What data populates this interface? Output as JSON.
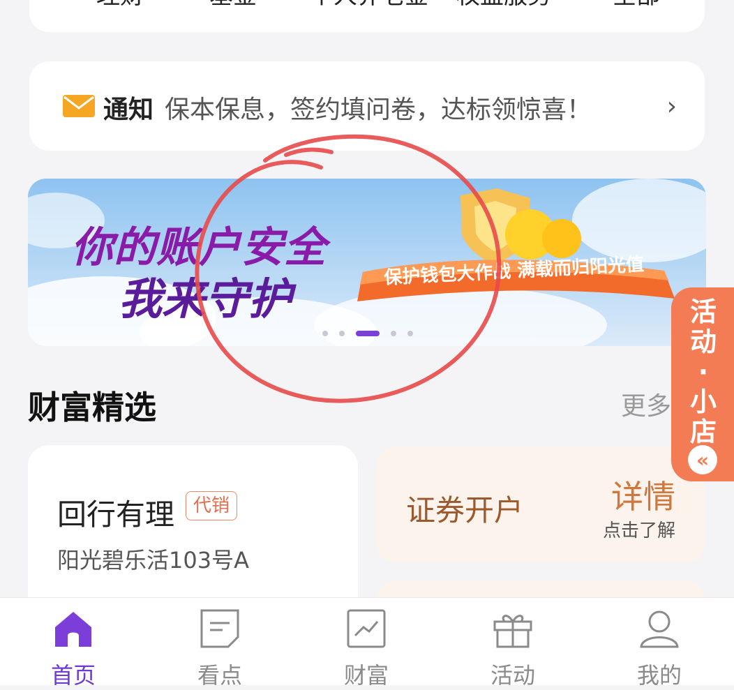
{
  "top_entries": [
    "理财",
    "基金",
    "个人养老金",
    "权益服务",
    "全部"
  ],
  "notice": {
    "title": "通知",
    "text": "保本保息，签约填问卷，达标领惊喜！",
    "chevron": "›"
  },
  "banner": {
    "line1": "你的账户安全",
    "line2": "我来守护",
    "ribbon": "保护钱包大作战 满载而归阳光值",
    "dots_total": 5,
    "active_dot": 3
  },
  "section": {
    "title": "财富精选",
    "more": "更多"
  },
  "float_shop": {
    "label": "活动·小店",
    "collapse": "«"
  },
  "product": {
    "name": "回行有理",
    "tag": "代销",
    "sub": "阳光碧乐活103号A"
  },
  "securities": {
    "title": "证券开户",
    "detail": "详情",
    "hint": "点击了解"
  },
  "tabbar": [
    {
      "label": "首页",
      "icon": "home-icon",
      "active": true
    },
    {
      "label": "看点",
      "icon": "note-icon",
      "active": false
    },
    {
      "label": "财富",
      "icon": "chart-icon",
      "active": false
    },
    {
      "label": "活动",
      "icon": "gift-icon",
      "active": false
    },
    {
      "label": "我的",
      "icon": "user-icon",
      "active": false
    }
  ],
  "colors": {
    "accent": "#6e3ad1",
    "float": "#f47c55",
    "annotation": "#e84a4a"
  }
}
